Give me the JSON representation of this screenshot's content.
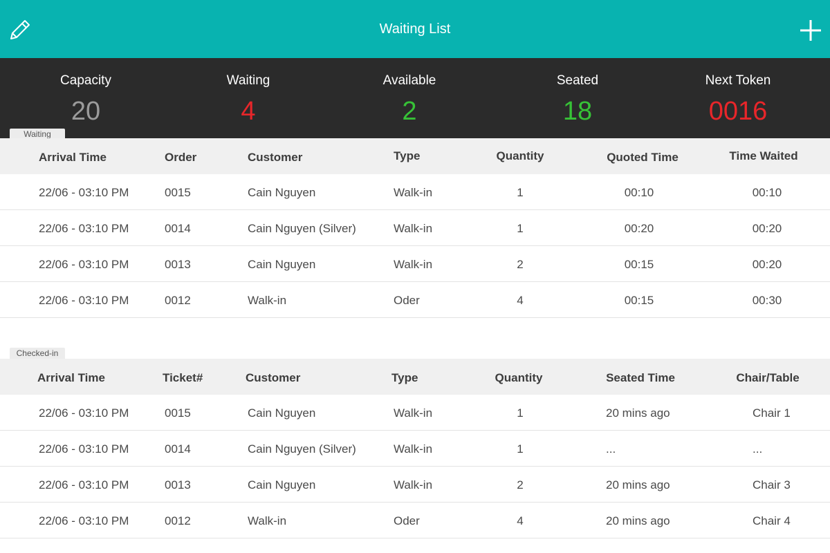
{
  "header": {
    "title": "Waiting List"
  },
  "stats": [
    {
      "label": "Capacity",
      "value": "20",
      "color": "#9b9b9b"
    },
    {
      "label": "Waiting",
      "value": "4",
      "color": "#e8262a"
    },
    {
      "label": "Available",
      "value": "2",
      "color": "#37c237"
    },
    {
      "label": "Seated",
      "value": "18",
      "color": "#37c237"
    },
    {
      "label": "Next Token",
      "value": "0016",
      "color": "#e8262a"
    }
  ],
  "waiting": {
    "tab_label": "Waiting",
    "columns": [
      "Arrival Time",
      "Order",
      "Customer",
      "Type",
      "Quantity",
      "Quoted Time",
      "Time Waited"
    ],
    "rows": [
      [
        "22/06 - 03:10 PM",
        "0015",
        "Cain Nguyen",
        "Walk-in",
        "1",
        "00:10",
        "00:10"
      ],
      [
        "22/06 - 03:10 PM",
        "0014",
        "Cain Nguyen (Silver)",
        "Walk-in",
        "1",
        "00:20",
        "00:20"
      ],
      [
        "22/06 - 03:10 PM",
        "0013",
        "Cain Nguyen",
        "Walk-in",
        "2",
        "00:15",
        "00:20"
      ],
      [
        "22/06 - 03:10 PM",
        "0012",
        "Walk-in",
        "Oder",
        "4",
        "00:15",
        "00:30"
      ]
    ]
  },
  "checked_in": {
    "tab_label": "Checked-in",
    "columns": [
      "Arrival Time",
      "Ticket#",
      "Customer",
      "Type",
      "Quantity",
      "Seated Time",
      "Chair/Table"
    ],
    "rows": [
      [
        "22/06 - 03:10 PM",
        "0015",
        "Cain Nguyen",
        "Walk-in",
        "1",
        "20 mins ago",
        "Chair 1"
      ],
      [
        "22/06 - 03:10 PM",
        "0014",
        "Cain Nguyen (Silver)",
        "Walk-in",
        "1",
        "...",
        "..."
      ],
      [
        "22/06 - 03:10 PM",
        "0013",
        "Cain Nguyen",
        "Walk-in",
        "2",
        "20 mins ago",
        "Chair 3"
      ],
      [
        "22/06 - 03:10 PM",
        "0012",
        "Walk-in",
        "Oder",
        "4",
        "20 mins ago",
        "Chair 4"
      ]
    ]
  },
  "colors": {
    "accent": "#08b3b0",
    "stats_bg": "#2b2b2b"
  },
  "icons": {
    "left": "pencil-icon",
    "right": "plus-icon"
  }
}
